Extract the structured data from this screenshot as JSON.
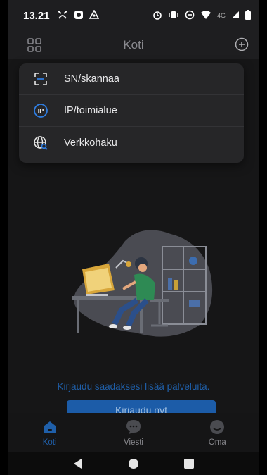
{
  "status_bar": {
    "time": "13.21",
    "network": "4G"
  },
  "app_bar": {
    "title": "Koti"
  },
  "menu": {
    "items": [
      {
        "label": "SN/skannaa",
        "icon": "scan-icon"
      },
      {
        "label": "IP/toimialue",
        "icon": "ip-icon"
      },
      {
        "label": "Verkkohaku",
        "icon": "globe-search-icon"
      }
    ]
  },
  "main": {
    "login_prompt": "Kirjaudu saadaksesi lisää palveluita.",
    "login_button": "Kirjaudu nyt"
  },
  "bottom_nav": {
    "tabs": [
      {
        "label": "Koti",
        "active": true
      },
      {
        "label": "Viesti",
        "active": false
      },
      {
        "label": "Oma",
        "active": false
      }
    ]
  },
  "colors": {
    "accent": "#1f5fa9",
    "background": "#161617",
    "menu_bg": "#262628"
  }
}
